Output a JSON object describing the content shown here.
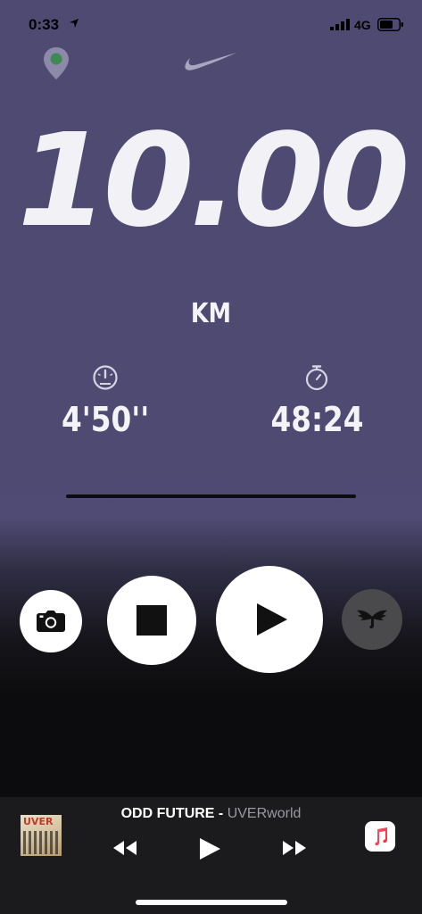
{
  "status_bar": {
    "time": "0:33",
    "network": "4G",
    "icons": [
      "location-arrow-icon",
      "signal-bars-icon",
      "battery-icon"
    ]
  },
  "header": {
    "icons": [
      "gps-pin-icon",
      "nike-swoosh-logo"
    ]
  },
  "run": {
    "distance": "10.00",
    "distance_unit": "KM",
    "pace": "4'50''",
    "pace_icon": "speedometer-icon",
    "duration": "48:24",
    "duration_icon": "stopwatch-icon"
  },
  "controls": {
    "icons": [
      "camera-icon",
      "stop-icon",
      "play-icon",
      "music-wings-icon"
    ]
  },
  "now_playing": {
    "title": "ODD FUTURE",
    "separator": " - ",
    "artist": "UVERworld",
    "album_art_text": "UVER",
    "icons": [
      "rewind-icon",
      "play-icon",
      "fast-forward-icon",
      "apple-music-icon"
    ]
  },
  "colors": {
    "top_background": "#4e4a72",
    "bottom_background": "#0c0c0e",
    "player_bar": "#1b1b1d",
    "music_button": "#4a4a4c"
  }
}
